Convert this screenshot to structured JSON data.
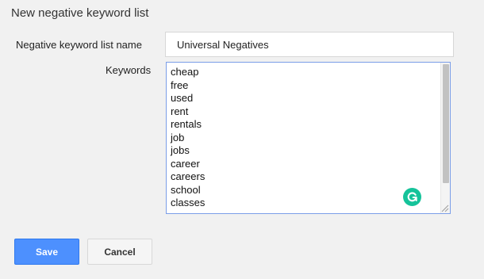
{
  "dialog": {
    "title": "New negative keyword list"
  },
  "form": {
    "name_label": "Negative keyword list name",
    "name_value": "Universal Negatives",
    "keywords_label": "Keywords",
    "keywords": [
      "cheap",
      "free",
      "used",
      "rent",
      "rentals",
      "job",
      "jobs",
      "career",
      "careers",
      "school",
      "classes"
    ]
  },
  "buttons": {
    "save_label": "Save",
    "cancel_label": "Cancel"
  },
  "icons": {
    "grammarly": "grammarly-icon",
    "resize": "resize-handle-icon"
  },
  "colors": {
    "accent": "#4d90fe",
    "grammarly": "#15c39a",
    "focus_border": "#7b9ee8"
  }
}
